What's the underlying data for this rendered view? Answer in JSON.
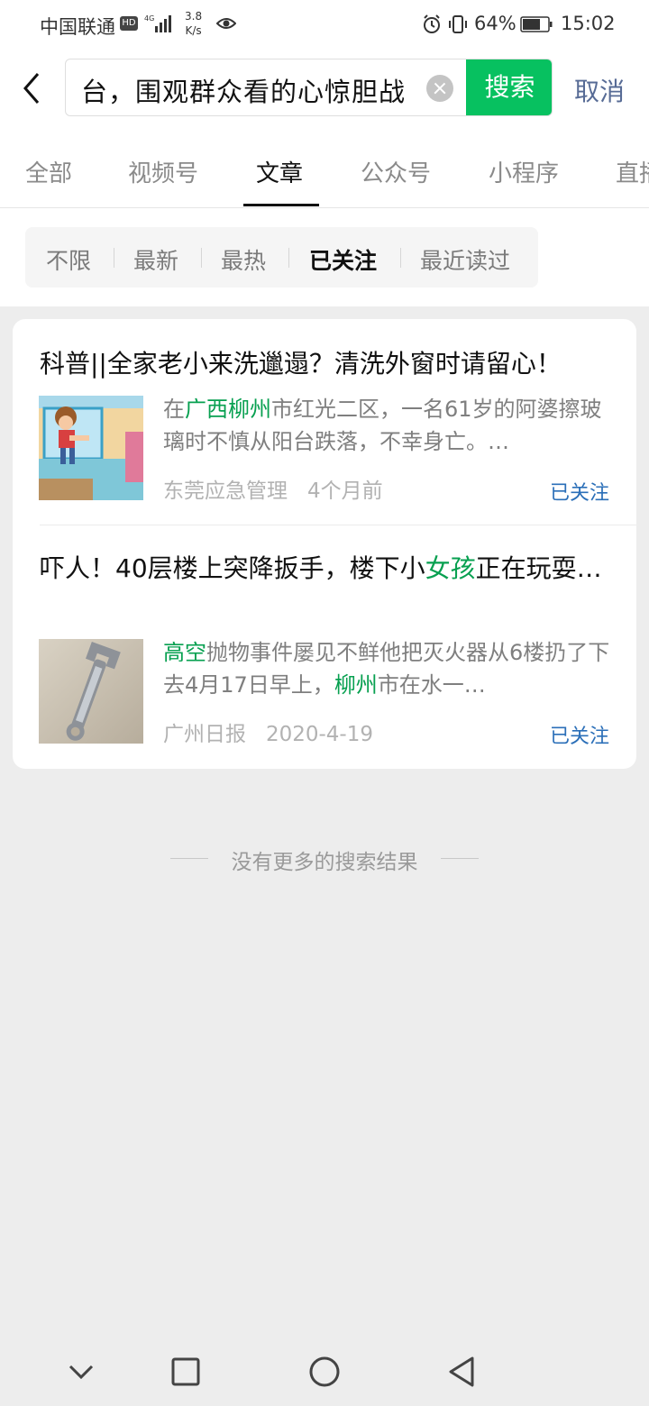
{
  "status_bar": {
    "carrier": "中国联通",
    "hd": "HD",
    "network": "4G",
    "speed_value": "3.8",
    "speed_unit": "K/s",
    "battery": "64%",
    "time": "15:02"
  },
  "search": {
    "query": "台，围观群众看的心惊胆战",
    "button": "搜索",
    "cancel": "取消"
  },
  "tabs": [
    {
      "label": "全部",
      "active": false
    },
    {
      "label": "视频号",
      "active": false
    },
    {
      "label": "文章",
      "active": true
    },
    {
      "label": "公众号",
      "active": false
    },
    {
      "label": "小程序",
      "active": false
    },
    {
      "label": "直播",
      "active": false
    }
  ],
  "filters": [
    {
      "label": "不限",
      "active": false
    },
    {
      "label": "最新",
      "active": false
    },
    {
      "label": "最热",
      "active": false
    },
    {
      "label": "已关注",
      "active": true
    },
    {
      "label": "最近读过",
      "active": false
    }
  ],
  "results": [
    {
      "title": "科普||全家老小来洗邋遢？清洗外窗时请留心！",
      "snippet": [
        {
          "t": "在",
          "hl": false
        },
        {
          "t": "广西柳州",
          "hl": true
        },
        {
          "t": "市红光二区，一名61岁的阿婆擦玻璃时不慎从阳台跌落，不幸身亡。…",
          "hl": false
        }
      ],
      "source": "东莞应急管理",
      "time": "4个月前",
      "follow": "已关注",
      "thumb": "cartoon-window-fall"
    },
    {
      "title": [
        {
          "t": "吓人！40层楼上突降扳手，楼下小",
          "hl": false
        },
        {
          "t": "女孩",
          "hl": true
        },
        {
          "t": "正在玩耍…",
          "hl": false
        }
      ],
      "snippet": [
        {
          "t": "高空",
          "hl": true
        },
        {
          "t": "抛物事件屡见不鲜他把灭火器从6楼扔了下去4月17日早上，",
          "hl": false
        },
        {
          "t": "柳州",
          "hl": true
        },
        {
          "t": "市在水一…",
          "hl": false
        }
      ],
      "source": "广州日报",
      "time": "2020-4-19",
      "follow": "已关注",
      "thumb": "wrench-photo"
    }
  ],
  "end_text": "没有更多的搜索结果",
  "colors": {
    "accent_green": "#07c160",
    "highlight_green": "#07a050",
    "link_blue": "#576b95",
    "follow_blue": "#2b6fb8"
  },
  "icons": [
    "back-arrow-icon",
    "clear-icon",
    "eye-icon",
    "alarm-icon",
    "vibrate-icon",
    "battery-icon",
    "signal-icon",
    "nav-down-icon",
    "nav-square-icon",
    "nav-circle-icon",
    "nav-back-triangle-icon"
  ]
}
